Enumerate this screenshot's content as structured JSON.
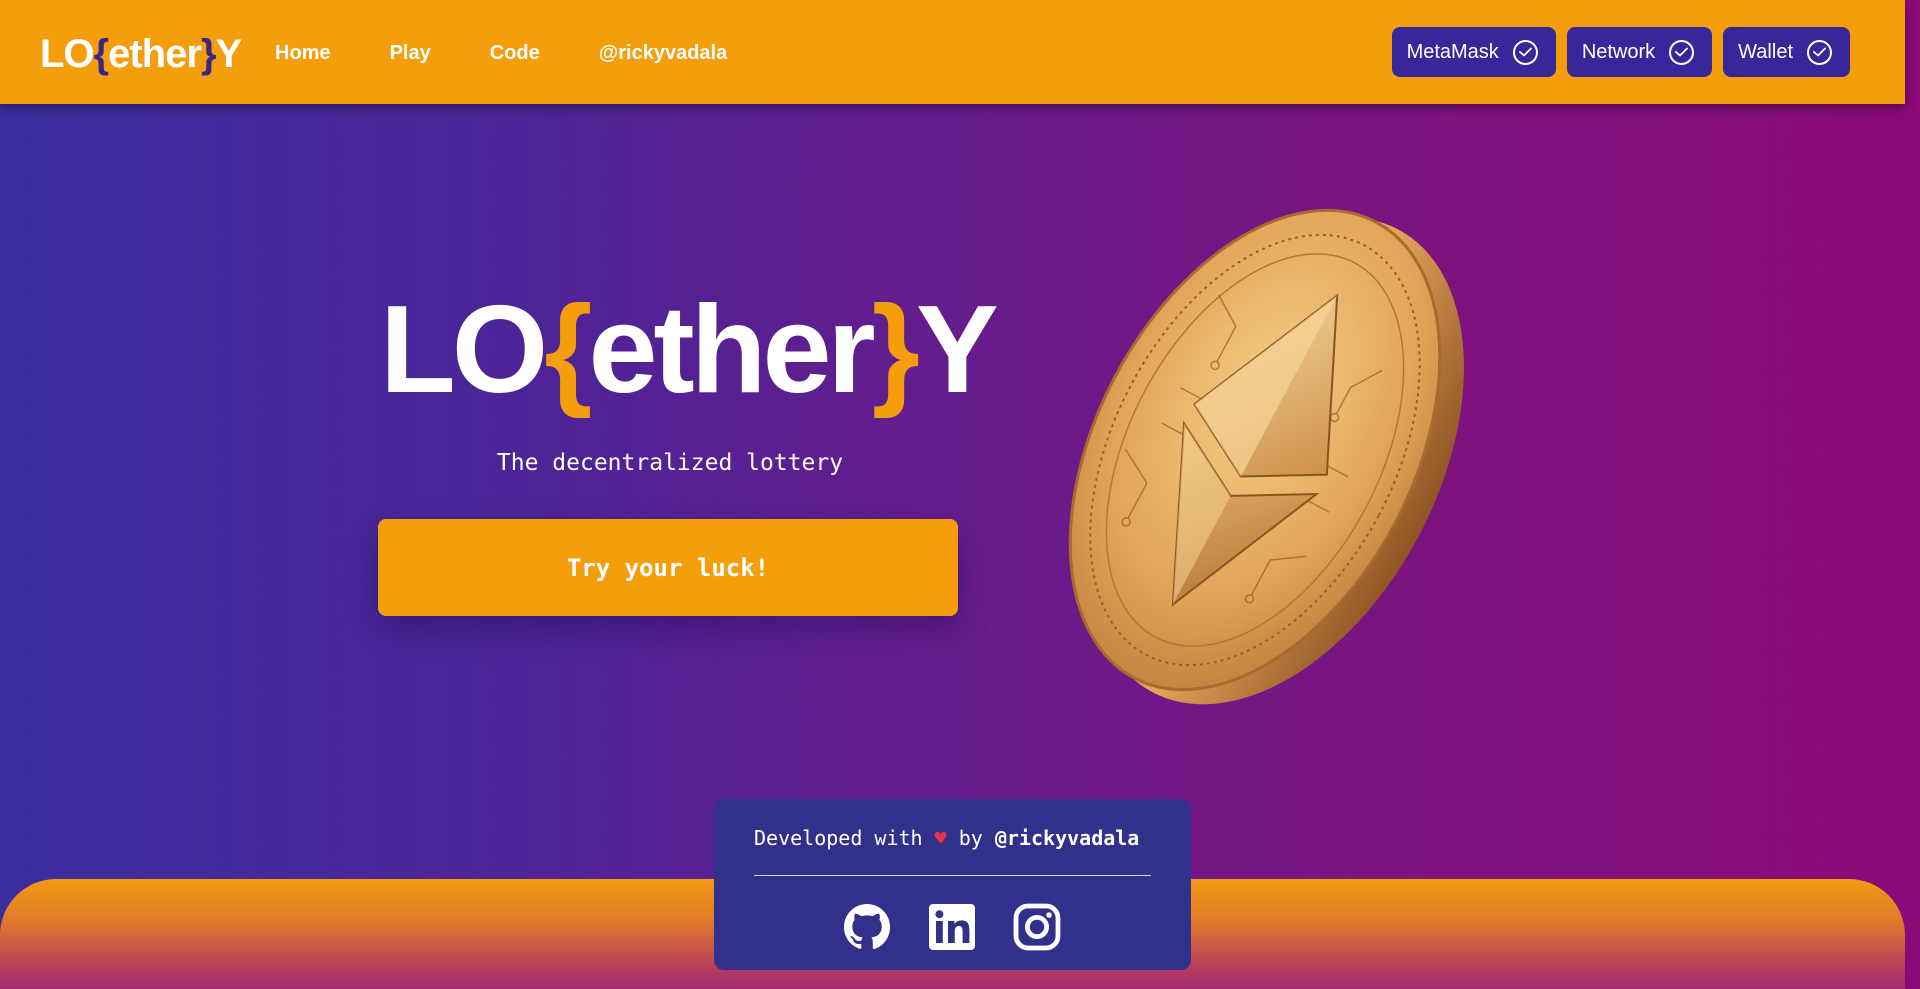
{
  "header": {
    "logo": {
      "part1": "LO",
      "brace_open": "{",
      "middle": "ether",
      "brace_close": "}",
      "part2": "Y"
    },
    "nav": [
      {
        "label": "Home"
      },
      {
        "label": "Play"
      },
      {
        "label": "Code"
      },
      {
        "label": "@rickyvadala"
      }
    ],
    "status": [
      {
        "label": "MetaMask",
        "icon": "check-circle-icon"
      },
      {
        "label": "Network",
        "icon": "check-circle-icon"
      },
      {
        "label": "Wallet",
        "icon": "check-circle-icon"
      }
    ]
  },
  "hero": {
    "title": {
      "part1": "LO",
      "brace_open": "{",
      "middle": "ether",
      "brace_close": "}",
      "part2": "Y"
    },
    "tagline": "The decentralized lottery",
    "cta_label": "Try your luck!",
    "image": "ethereum-gold-coin"
  },
  "footer": {
    "credit_prefix": "Developed with",
    "heart": "♥",
    "credit_by": "by",
    "handle": "@rickyvadala",
    "socials": [
      {
        "icon": "github-icon"
      },
      {
        "icon": "linkedin-icon"
      },
      {
        "icon": "instagram-icon"
      }
    ]
  },
  "colors": {
    "accent_orange": "#f49e0c",
    "button_indigo": "#37279a",
    "footer_card": "#31308a",
    "gradient_start": "#3a2d9e",
    "gradient_end": "#8a0a77",
    "heart_red": "#e0344a"
  }
}
